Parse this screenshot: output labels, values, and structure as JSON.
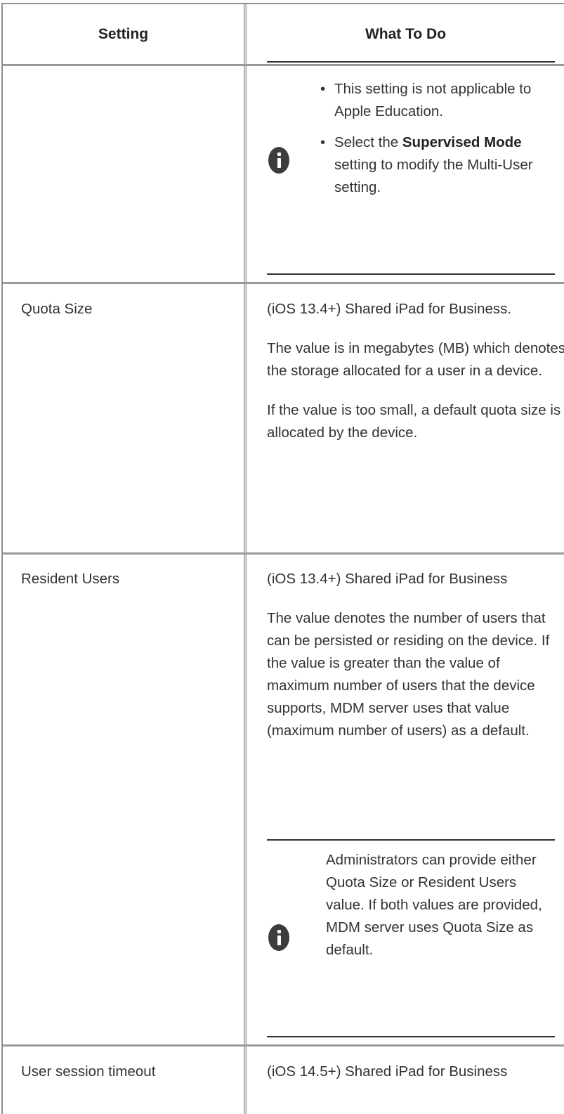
{
  "table": {
    "headers": {
      "setting": "Setting",
      "what_to_do": "What To Do"
    },
    "note1": {
      "items": [
        {
          "text": "This setting is not applicable to Apple Education."
        },
        {
          "pre": "Select the ",
          "bold": "Supervised Mode",
          "post": " setting to modify the Multi-User setting."
        }
      ]
    },
    "rows": [
      {
        "setting": "Quota Size",
        "paragraphs": [
          "(iOS 13.4+) Shared iPad for Business.",
          "The value is in megabytes (MB) which denotes the storage allocated for a user in a device.",
          "If the value is too small, a default quota size is allocated by the device."
        ]
      },
      {
        "setting": "Resident Users",
        "paragraphs": [
          "(iOS 13.4+) Shared iPad for Business",
          "The value denotes the number of users that can be persisted or residing on the device. If the value is greater than the value of maximum number of users that the device supports, MDM server uses that value (maximum number of users) as a default."
        ],
        "note": "Administrators can provide either Quota Size or Resident Users value. If both values are provided, MDM server uses Quota Size as default."
      },
      {
        "setting": "User session timeout",
        "paragraphs": [
          "(iOS 14.5+) Shared iPad for Business"
        ]
      }
    ]
  }
}
